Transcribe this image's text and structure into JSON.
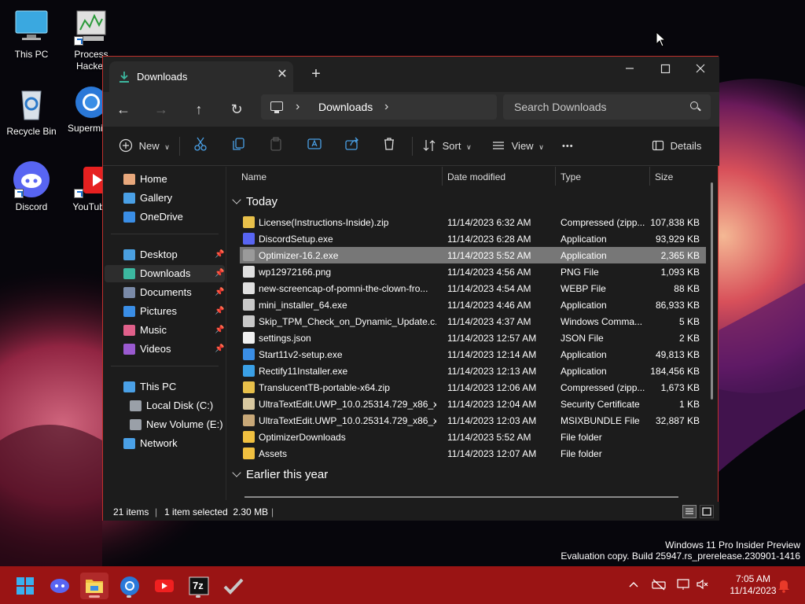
{
  "desktop": {
    "icons": [
      {
        "label": "This PC"
      },
      {
        "label": "Process Hacker"
      },
      {
        "label": "Recycle Bin"
      },
      {
        "label": "Supermium"
      },
      {
        "label": "Discord"
      },
      {
        "label": "YouTube"
      }
    ]
  },
  "window": {
    "tab_title": "Downloads",
    "tab_close": "✕",
    "new_tab": "+",
    "controls": {
      "minimize": "—",
      "maximize": "☐",
      "close": "✕"
    },
    "nav": {
      "back": "←",
      "forward": "→",
      "up": "↑",
      "refresh": "↻"
    },
    "breadcrumb": {
      "location": "Downloads",
      "separator": "›"
    },
    "search": {
      "placeholder": "Search Downloads"
    },
    "toolbar": {
      "new_label": "New",
      "sort_label": "Sort",
      "view_label": "View",
      "more_label": "•••",
      "details_label": "Details"
    },
    "sidebar": {
      "items": [
        {
          "label": "Home",
          "icon": "home-icon",
          "pinned": false,
          "color": "#e8a87c"
        },
        {
          "label": "Gallery",
          "icon": "gallery-icon",
          "pinned": false,
          "color": "#4aa0e6"
        },
        {
          "label": "OneDrive",
          "icon": "cloud-icon",
          "pinned": false,
          "color": "#3a8ee6"
        },
        {
          "label": "Desktop",
          "icon": "desktop-icon",
          "pinned": true,
          "color": "#4a9fe0"
        },
        {
          "label": "Downloads",
          "icon": "download-icon",
          "pinned": true,
          "color": "#3cb8a0"
        },
        {
          "label": "Documents",
          "icon": "documents-icon",
          "pinned": true,
          "color": "#7a8aa8"
        },
        {
          "label": "Pictures",
          "icon": "pictures-icon",
          "pinned": true,
          "color": "#3a8ee6"
        },
        {
          "label": "Music",
          "icon": "music-icon",
          "pinned": true,
          "color": "#e0608a"
        },
        {
          "label": "Videos",
          "icon": "videos-icon",
          "pinned": true,
          "color": "#9a5ad0"
        },
        {
          "label": "This PC",
          "icon": "pc-icon",
          "pinned": false,
          "color": "#4aa0e6"
        },
        {
          "label": "Local Disk (C:)",
          "icon": "drive-icon",
          "pinned": false,
          "color": "#9aa0a8"
        },
        {
          "label": "New Volume (E:)",
          "icon": "drive-icon",
          "pinned": false,
          "color": "#9aa0a8"
        },
        {
          "label": "Network",
          "icon": "network-icon",
          "pinned": false,
          "color": "#4aa0e6"
        }
      ],
      "pin_glyph": "📌"
    },
    "columns": {
      "name": "Name",
      "date": "Date modified",
      "type": "Type",
      "size": "Size"
    },
    "groups": {
      "today": "Today",
      "earlier": "Earlier this year"
    },
    "files": [
      {
        "name": "License(Instructions-Inside).zip",
        "date": "11/14/2023 6:32 AM",
        "type": "Compressed (zipp...",
        "size": "107,838 KB",
        "icon": "zip-icon",
        "color": "#e8c04a"
      },
      {
        "name": "DiscordSetup.exe",
        "date": "11/14/2023 6:28 AM",
        "type": "Application",
        "size": "93,929 KB",
        "icon": "discord-icon",
        "color": "#5865f2"
      },
      {
        "name": "Optimizer-16.2.exe",
        "date": "11/14/2023 5:52 AM",
        "type": "Application",
        "size": "2,365 KB",
        "icon": "check-icon",
        "color": "#9a9a9a",
        "selected": true
      },
      {
        "name": "wp12972166.png",
        "date": "11/14/2023 4:56 AM",
        "type": "PNG File",
        "size": "1,093 KB",
        "icon": "image-file-icon",
        "color": "#e0e0e0"
      },
      {
        "name": "new-screencap-of-pomni-the-clown-fro...",
        "date": "11/14/2023 4:54 AM",
        "type": "WEBP File",
        "size": "88 KB",
        "icon": "image-file-icon",
        "color": "#e0e0e0"
      },
      {
        "name": "mini_installer_64.exe",
        "date": "11/14/2023 4:46 AM",
        "type": "Application",
        "size": "86,933 KB",
        "icon": "installer-icon",
        "color": "#c8c8c8"
      },
      {
        "name": "Skip_TPM_Check_on_Dynamic_Update.c...",
        "date": "11/14/2023 4:37 AM",
        "type": "Windows Comma...",
        "size": "5 KB",
        "icon": "script-icon",
        "color": "#c8c8c8"
      },
      {
        "name": "settings.json",
        "date": "11/14/2023 12:57 AM",
        "type": "JSON File",
        "size": "2 KB",
        "icon": "file-icon",
        "color": "#f0f0f0"
      },
      {
        "name": "Start11v2-setup.exe",
        "date": "11/14/2023 12:14 AM",
        "type": "Application",
        "size": "49,813 KB",
        "icon": "start11-icon",
        "color": "#3a8ee6"
      },
      {
        "name": "Rectify11Installer.exe",
        "date": "11/14/2023 12:13 AM",
        "type": "Application",
        "size": "184,456 KB",
        "icon": "rectify-icon",
        "color": "#3aa0e6"
      },
      {
        "name": "TranslucentTB-portable-x64.zip",
        "date": "11/14/2023 12:06 AM",
        "type": "Compressed (zipp...",
        "size": "1,673 KB",
        "icon": "zip-icon",
        "color": "#e8c04a"
      },
      {
        "name": "UltraTextEdit.UWP_10.0.25314.729_x86_x6...",
        "date": "11/14/2023 12:04 AM",
        "type": "Security Certificate",
        "size": "1 KB",
        "icon": "certificate-icon",
        "color": "#d8c8a0"
      },
      {
        "name": "UltraTextEdit.UWP_10.0.25314.729_x86_x6...",
        "date": "11/14/2023 12:03 AM",
        "type": "MSIXBUNDLE File",
        "size": "32,887 KB",
        "icon": "package-icon",
        "color": "#c8a878"
      },
      {
        "name": "OptimizerDownloads",
        "date": "11/14/2023 5:52 AM",
        "type": "File folder",
        "size": "",
        "icon": "folder-icon",
        "color": "#f0c040"
      },
      {
        "name": "Assets",
        "date": "11/14/2023 12:07 AM",
        "type": "File folder",
        "size": "",
        "icon": "folder-icon",
        "color": "#f0c040"
      }
    ],
    "status": {
      "items": "21 items",
      "selected": "1 item selected  2.30 MB"
    }
  },
  "watermark": {
    "line1": "Windows 11 Pro Insider Preview",
    "line2": "Evaluation copy. Build 25947.rs_prerelease.230901-1416"
  },
  "taskbar": {
    "apps": [
      {
        "name": "start-button",
        "icon": "windows-icon"
      },
      {
        "name": "discord",
        "icon": "discord-icon"
      },
      {
        "name": "file-explorer",
        "icon": "folder-icon",
        "active": true
      },
      {
        "name": "supermium",
        "icon": "browser-icon"
      },
      {
        "name": "youtube",
        "icon": "youtube-icon"
      },
      {
        "name": "7zip",
        "icon": "7zip-icon",
        "label": "7z"
      },
      {
        "name": "optimizer",
        "icon": "check-icon"
      }
    ],
    "tray": {
      "chevron": "^",
      "time": "7:05 AM",
      "date": "11/14/2023"
    }
  }
}
